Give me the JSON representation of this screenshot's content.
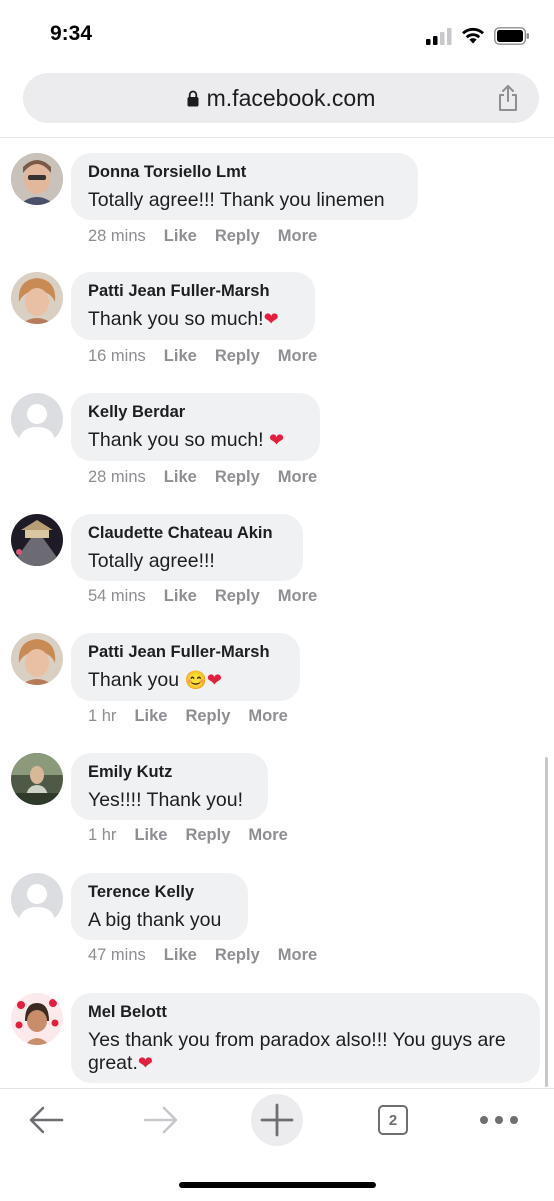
{
  "status": {
    "time": "9:34"
  },
  "browser": {
    "url": "m.facebook.com",
    "tab_count": "2"
  },
  "comments": [
    {
      "author": "Donna Torsiello Lmt",
      "text": "Totally agree!!! Thank you linemen",
      "time": "28 mins",
      "like": "Like",
      "reply": "Reply",
      "more": "More"
    },
    {
      "author": "Patti Jean Fuller-Marsh",
      "text": "Thank you so much!",
      "emoji": "❤",
      "time": "16 mins",
      "like": "Like",
      "reply": "Reply",
      "more": "More"
    },
    {
      "author": "Kelly Berdar",
      "text": "Thank you so much! ",
      "emoji": "❤",
      "time": "28 mins",
      "like": "Like",
      "reply": "Reply",
      "more": "More"
    },
    {
      "author": "Claudette Chateau Akin",
      "text": "Totally agree!!!",
      "time": "54 mins",
      "like": "Like",
      "reply": "Reply",
      "more": "More"
    },
    {
      "author": "Patti Jean Fuller-Marsh",
      "text": "Thank you",
      "emoji": "😊❤",
      "time": "1 hr",
      "like": "Like",
      "reply": "Reply",
      "more": "More"
    },
    {
      "author": "Emily Kutz",
      "text": "Yes!!!! Thank you!",
      "time": "1 hr",
      "like": "Like",
      "reply": "Reply",
      "more": "More"
    },
    {
      "author": "Terence Kelly",
      "text": "A big thank you",
      "time": "47 mins",
      "like": "Like",
      "reply": "Reply",
      "more": "More"
    },
    {
      "author": "Mel Belott",
      "text": "Yes thank you from paradox also!!! You guys are great.",
      "emoji": "❤"
    }
  ],
  "colors": {
    "bubble": "#f0f1f3",
    "meta": "#8e8e93",
    "heart": "#e41e3f"
  }
}
